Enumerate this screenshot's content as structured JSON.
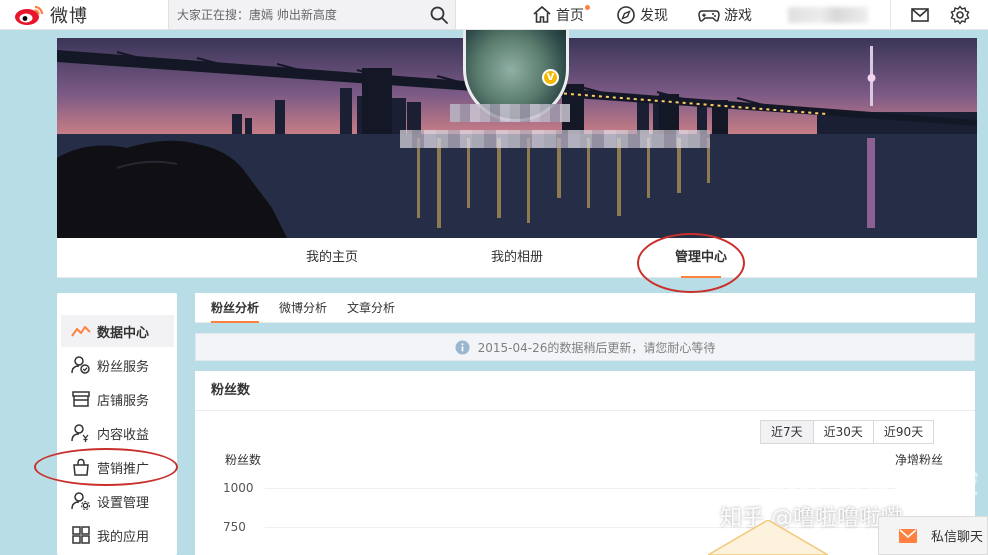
{
  "topbar": {
    "logo_text": "微博",
    "search_placeholder": "大家正在搜：唐嫣 帅出新高度",
    "nav": [
      {
        "label": "首页",
        "icon": "home-icon"
      },
      {
        "label": "发现",
        "icon": "compass-icon"
      },
      {
        "label": "游戏",
        "icon": "gamepad-icon"
      }
    ]
  },
  "tabs": [
    {
      "label": "我的主页"
    },
    {
      "label": "我的相册"
    },
    {
      "label": "管理中心"
    }
  ],
  "sidebar": {
    "items": [
      {
        "label": "数据中心",
        "icon": "trend-chart-icon"
      },
      {
        "label": "粉丝服务",
        "icon": "fans-service-icon"
      },
      {
        "label": "店铺服务",
        "icon": "store-icon"
      },
      {
        "label": "内容收益",
        "icon": "content-revenue-icon"
      },
      {
        "label": "营销推广",
        "icon": "bag-icon"
      },
      {
        "label": "设置管理",
        "icon": "user-settings-icon"
      },
      {
        "label": "我的应用",
        "icon": "apps-grid-icon"
      }
    ]
  },
  "subtabs": [
    {
      "label": "粉丝分析"
    },
    {
      "label": "微博分析"
    },
    {
      "label": "文章分析"
    }
  ],
  "notice": {
    "text": "2015-04-26的数据稍后更新，请您耐心等待",
    "icon": "info-icon"
  },
  "fans_card": {
    "title": "粉丝数",
    "ranges": [
      {
        "label": "近7天"
      },
      {
        "label": "近30天"
      },
      {
        "label": "近90天"
      }
    ],
    "left_axis_label": "粉丝数",
    "right_axis_label": "净增粉丝",
    "ticks": [
      "1000",
      "750"
    ]
  },
  "watermarks": {
    "baidu": "Bai du 经验",
    "zhihu": "知乎 @噜啦噜啦嘞"
  },
  "chat": {
    "label": "私信聊天",
    "icon": "envelope-icon"
  },
  "colors": {
    "accent": "#ff8140",
    "annotation_red": "#c9302c",
    "verify_badge": "#f6b800",
    "page_bg": "#b9dde6"
  }
}
